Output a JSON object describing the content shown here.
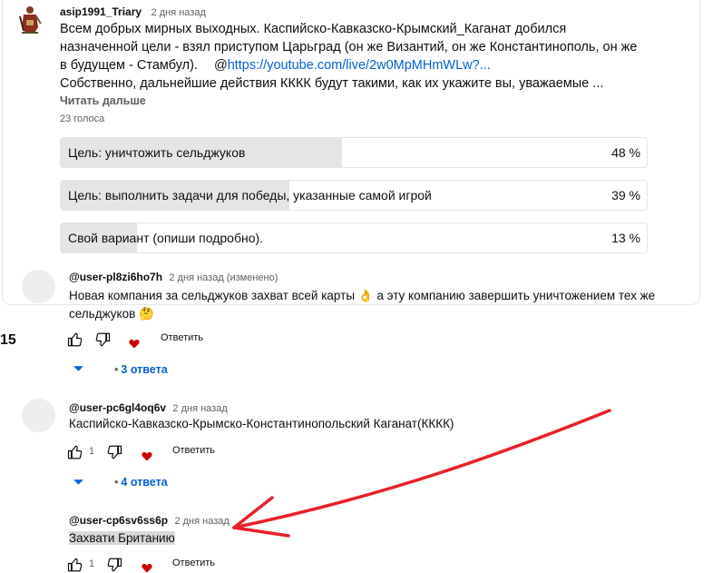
{
  "post": {
    "author": "asip1991_Triary",
    "time": "2 дня назад",
    "lines": [
      "Всем добрых мирных выходных. Каспийско-Кавказско-Крымский_Каганат добился",
      "назначенной цели - взял приступом Царьград (он же Византий, он же Константинополь, он же",
      "в будущем - Стамбул).",
      "https://youtube.com/live/2w0MpMHmWLw?...",
      "Собственно, дальнейшие действия КККК будут такими, как их укажите вы, уважаемые ..."
    ],
    "mention_prefix": "@",
    "read_more": "Читать дальше",
    "votes": "23 голоса",
    "options": [
      {
        "label": "Цель: уничтожить сельджуков",
        "percent": "48 %",
        "fill": 48
      },
      {
        "label": "Цель: выполнить задачи для победы, указанные самой игрой",
        "percent": "39 %",
        "fill": 39
      },
      {
        "label": "Свой вариант (опиши подробно).",
        "percent": "13 %",
        "fill": 13
      }
    ]
  },
  "side_number": "15",
  "comments": [
    {
      "author": "@user-pl8zi6ho7h",
      "time": "2 дня назад (изменено)",
      "text_line1": "Новая компания за сельджуков захват всей карты 👌 а эту компанию завершить уничтожением тех же",
      "text_line2": "сельджуков 🤔",
      "likes": "",
      "reply_label": "Ответить",
      "replies": "3 ответа"
    },
    {
      "author": "@user-pc6gl4oq6v",
      "time": "2 дня назад",
      "text_line1": "Каспийско-Кавказско-Крымско-Константинопольский Каганат(КККК)",
      "likes": "1",
      "reply_label": "Ответить",
      "replies": "4 ответа"
    },
    {
      "author": "@user-cp6sv6ss6p",
      "time": "2 дня назад",
      "text_line1": "Захвати Британию",
      "likes": "1",
      "reply_label": "Ответить"
    }
  ],
  "colors": {
    "accent_link": "#065fd4",
    "heart": "#cc0000",
    "annotation_arrow": "#e8202a",
    "poll_fill": "#e5e5e5"
  },
  "icons": [
    "thumbs-up-icon",
    "thumbs-down-icon",
    "heart-icon",
    "chevron-down-icon",
    "annotation-arrow"
  ]
}
